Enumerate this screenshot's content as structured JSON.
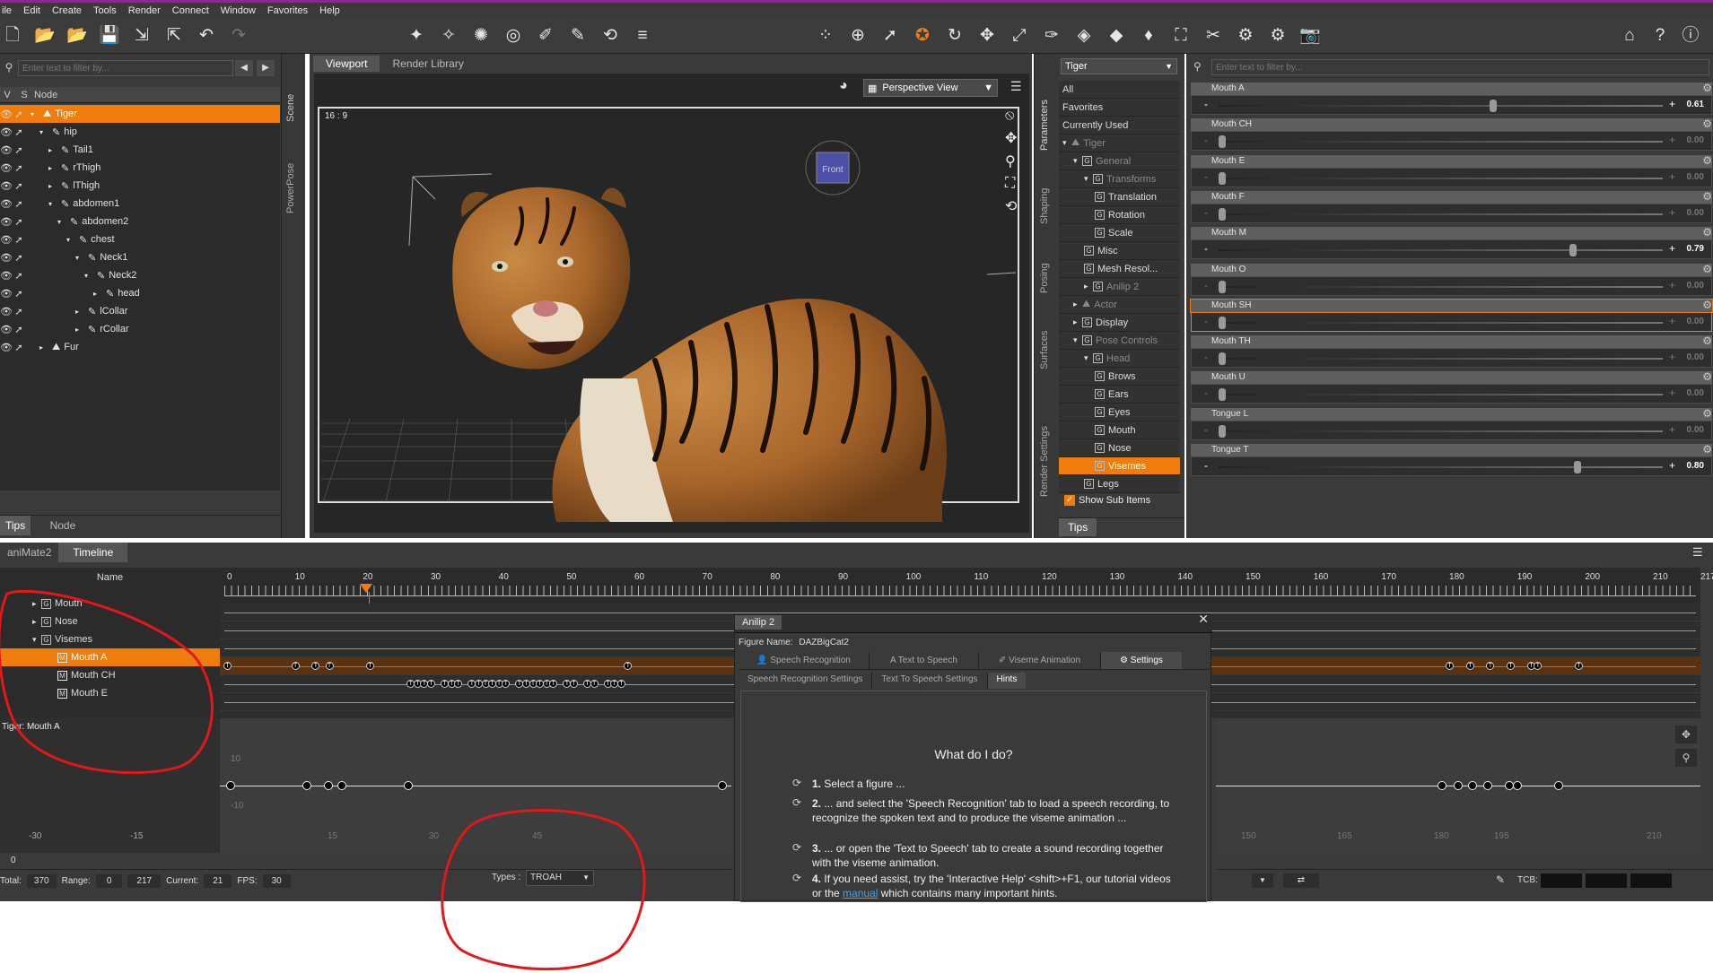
{
  "menu": [
    "ile",
    "Edit",
    "Create",
    "Tools",
    "Render",
    "Connect",
    "Window",
    "Favorites",
    "Help"
  ],
  "scene": {
    "filter_placeholder": "Enter text to filter by...",
    "col_v": "V",
    "col_s": "S",
    "col_node": "Node",
    "nodes": [
      {
        "label": "Tiger",
        "indent": 0,
        "sel": true
      },
      {
        "label": "hip",
        "indent": 1
      },
      {
        "label": "Tail1",
        "indent": 2
      },
      {
        "label": "rThigh",
        "indent": 2
      },
      {
        "label": "lThigh",
        "indent": 2
      },
      {
        "label": "abdomen1",
        "indent": 2
      },
      {
        "label": "abdomen2",
        "indent": 3
      },
      {
        "label": "chest",
        "indent": 4
      },
      {
        "label": "Neck1",
        "indent": 5
      },
      {
        "label": "Neck2",
        "indent": 6
      },
      {
        "label": "head",
        "indent": 7
      },
      {
        "label": "lCollar",
        "indent": 5
      },
      {
        "label": "rCollar",
        "indent": 5
      },
      {
        "label": "Fur",
        "indent": 1
      }
    ],
    "bottom_tabs": [
      "Tips",
      "Node"
    ],
    "side_tabs": [
      "Scene",
      "PowerPose"
    ]
  },
  "viewport": {
    "tabs": [
      "Viewport",
      "Render Library"
    ],
    "camera": "Perspective View",
    "aspect": "16 : 9",
    "cube_label": "Front"
  },
  "params_nav": {
    "figure": "Tiger",
    "side_tabs": [
      "Parameters",
      "Shaping",
      "Posing",
      "Surfaces",
      "Render Settings"
    ],
    "items": [
      {
        "label": "All",
        "indent": 0,
        "g": false
      },
      {
        "label": "Favorites",
        "indent": 0,
        "g": false
      },
      {
        "label": "Currently Used",
        "indent": 0,
        "g": false
      },
      {
        "label": "Tiger",
        "indent": 0,
        "g": false,
        "dim": true,
        "arrow": "▾",
        "fig": true
      },
      {
        "label": "General",
        "indent": 1,
        "g": true,
        "dim": true,
        "arrow": "▾"
      },
      {
        "label": "Transforms",
        "indent": 2,
        "g": true,
        "dim": true,
        "arrow": "▾"
      },
      {
        "label": "Translation",
        "indent": 3,
        "g": true
      },
      {
        "label": "Rotation",
        "indent": 3,
        "g": true
      },
      {
        "label": "Scale",
        "indent": 3,
        "g": true
      },
      {
        "label": "Misc",
        "indent": 2,
        "g": true
      },
      {
        "label": "Mesh Resol...",
        "indent": 2,
        "g": true
      },
      {
        "label": "Anilip 2",
        "indent": 2,
        "g": true,
        "dim": true,
        "arrow": "▸"
      },
      {
        "label": "Actor",
        "indent": 1,
        "g": false,
        "dim": true,
        "arrow": "▸",
        "fig": true
      },
      {
        "label": "Display",
        "indent": 1,
        "g": true,
        "arrow": "▸"
      },
      {
        "label": "Pose Controls",
        "indent": 1,
        "g": true,
        "dim": true,
        "arrow": "▾"
      },
      {
        "label": "Head",
        "indent": 2,
        "g": true,
        "dim": true,
        "arrow": "▾"
      },
      {
        "label": "Brows",
        "indent": 3,
        "g": true
      },
      {
        "label": "Ears",
        "indent": 3,
        "g": true
      },
      {
        "label": "Eyes",
        "indent": 3,
        "g": true
      },
      {
        "label": "Mouth",
        "indent": 3,
        "g": true
      },
      {
        "label": "Nose",
        "indent": 3,
        "g": true
      },
      {
        "label": "Visemes",
        "indent": 3,
        "g": true,
        "sel": true
      },
      {
        "label": "Legs",
        "indent": 2,
        "g": true
      }
    ],
    "show_sub": "Show Sub Items",
    "bottom_tab": "Tips"
  },
  "params": {
    "filter_placeholder": "Enter text to filter by...",
    "items": [
      {
        "label": "Mouth A",
        "value": "0.61",
        "level": 0.61,
        "active": true
      },
      {
        "label": "Mouth CH",
        "value": "0.00",
        "level": 0,
        "active": false
      },
      {
        "label": "Mouth E",
        "value": "0.00",
        "level": 0,
        "active": false
      },
      {
        "label": "Mouth F",
        "value": "0.00",
        "level": 0,
        "active": false
      },
      {
        "label": "Mouth M",
        "value": "0.79",
        "level": 0.79,
        "active": true
      },
      {
        "label": "Mouth O",
        "value": "0.00",
        "level": 0,
        "active": false
      },
      {
        "label": "Mouth SH",
        "value": "0.00",
        "level": 0,
        "active": false,
        "hl": true
      },
      {
        "label": "Mouth TH",
        "value": "0.00",
        "level": 0,
        "active": false
      },
      {
        "label": "Mouth U",
        "value": "0.00",
        "level": 0,
        "active": false
      },
      {
        "label": "Tongue L",
        "value": "0.00",
        "level": 0,
        "active": false
      },
      {
        "label": "Tongue T",
        "value": "0.80",
        "level": 0.8,
        "active": true
      }
    ]
  },
  "timeline": {
    "tabs": [
      "aniMate2",
      "Timeline"
    ],
    "name_col": "Name",
    "ruler": [
      "0",
      "10",
      "20",
      "30",
      "40",
      "50",
      "60",
      "70",
      "80",
      "90",
      "100",
      "110",
      "120",
      "130",
      "140",
      "150",
      "160",
      "170",
      "180",
      "190",
      "200",
      "210",
      "217"
    ],
    "rows": [
      {
        "label": "Mouth",
        "indent": 1,
        "g": true,
        "arrow": "▸"
      },
      {
        "label": "Nose",
        "indent": 1,
        "g": true,
        "arrow": "▸"
      },
      {
        "label": "Visemes",
        "indent": 1,
        "g": true,
        "arrow": "▾"
      },
      {
        "label": "Mouth A",
        "indent": 2,
        "m": true,
        "sel": true
      },
      {
        "label": "Mouth CH",
        "indent": 2,
        "m": true
      },
      {
        "label": "Mouth E",
        "indent": 2,
        "m": true
      }
    ],
    "graph_label": "Tiger: Mouth A",
    "graph_axis_left": [
      "-30",
      "-15"
    ],
    "graph_axis_mid": [
      "15",
      "30",
      "45"
    ],
    "graph_axis_right": [
      "150",
      "165",
      "180",
      "195",
      "210"
    ],
    "graph_y": [
      "10",
      "-10"
    ],
    "zero": "0",
    "status": {
      "total_label": "Total:",
      "total": "370",
      "range_label": "Range:",
      "range_start": "0",
      "range_end": "217",
      "current_label": "Current:",
      "current": "21",
      "fps_label": "FPS:",
      "fps": "30",
      "types_label": "Types :",
      "types_value": "TROAH"
    },
    "tcb": "TCB:"
  },
  "anilip": {
    "title": "Anilip 2",
    "figure_label": "Figure Name:",
    "figure": "DAZBigCat2",
    "tabs": [
      "Speech Recognition",
      "Text to Speech",
      "Viseme Animation",
      "Settings"
    ],
    "subtabs": [
      "Speech Recognition Settings",
      "Text To Speech Settings",
      "Hints"
    ],
    "heading": "What do I do?",
    "hints": [
      {
        "num": "1.",
        "text": "Select a figure ..."
      },
      {
        "num": "2.",
        "text": "... and select the 'Speech Recognition' tab to load a speech recording, to recognize the spoken text and to produce the viseme animation ..."
      },
      {
        "num": "3.",
        "text": "... or open the 'Text to Speech' tab to create a sound recording together with the viseme animation."
      },
      {
        "num": "4.",
        "text": "If you need assist, try the 'Interactive Help' <shift>+F1, our tutorial videos or the",
        "link": "manual",
        "tail": "which contains many important hints."
      }
    ]
  },
  "colors": {
    "accent": "#f07c0c",
    "annotation": "#e01818"
  }
}
